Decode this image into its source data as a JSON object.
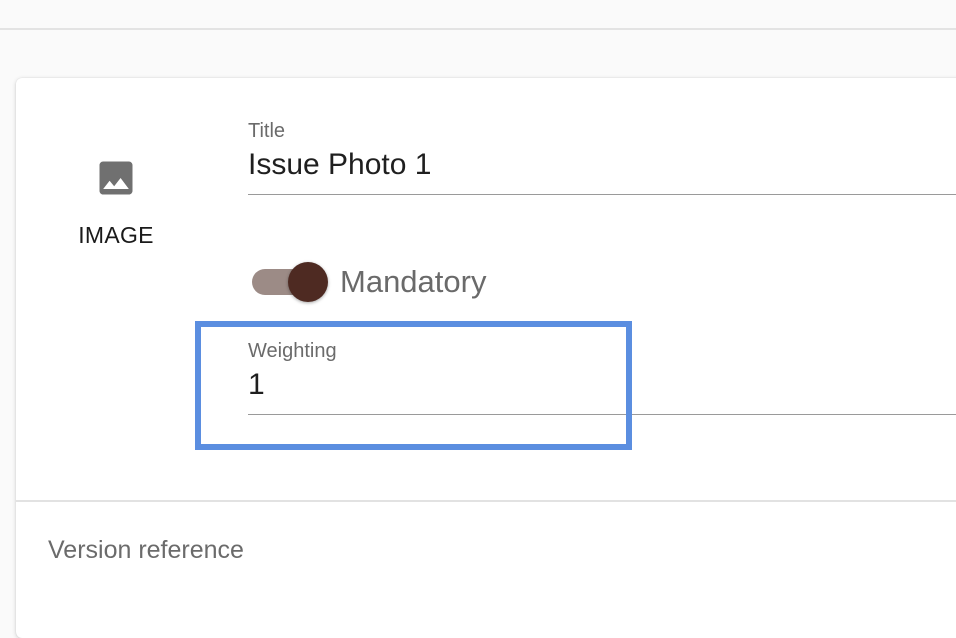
{
  "question_card": {
    "type_label": "IMAGE",
    "type_icon": "image-icon",
    "title_field": {
      "label": "Title",
      "value": "Issue Photo 1"
    },
    "mandatory_toggle": {
      "label": "Mandatory",
      "checked": true
    },
    "weighting_field": {
      "label": "Weighting",
      "value": "1"
    },
    "version_reference": {
      "label": "Version reference"
    }
  },
  "colors": {
    "highlight_border": "#5b8ee0",
    "toggle_thumb": "#4e2a22",
    "toggle_track": "#9c8b86"
  }
}
